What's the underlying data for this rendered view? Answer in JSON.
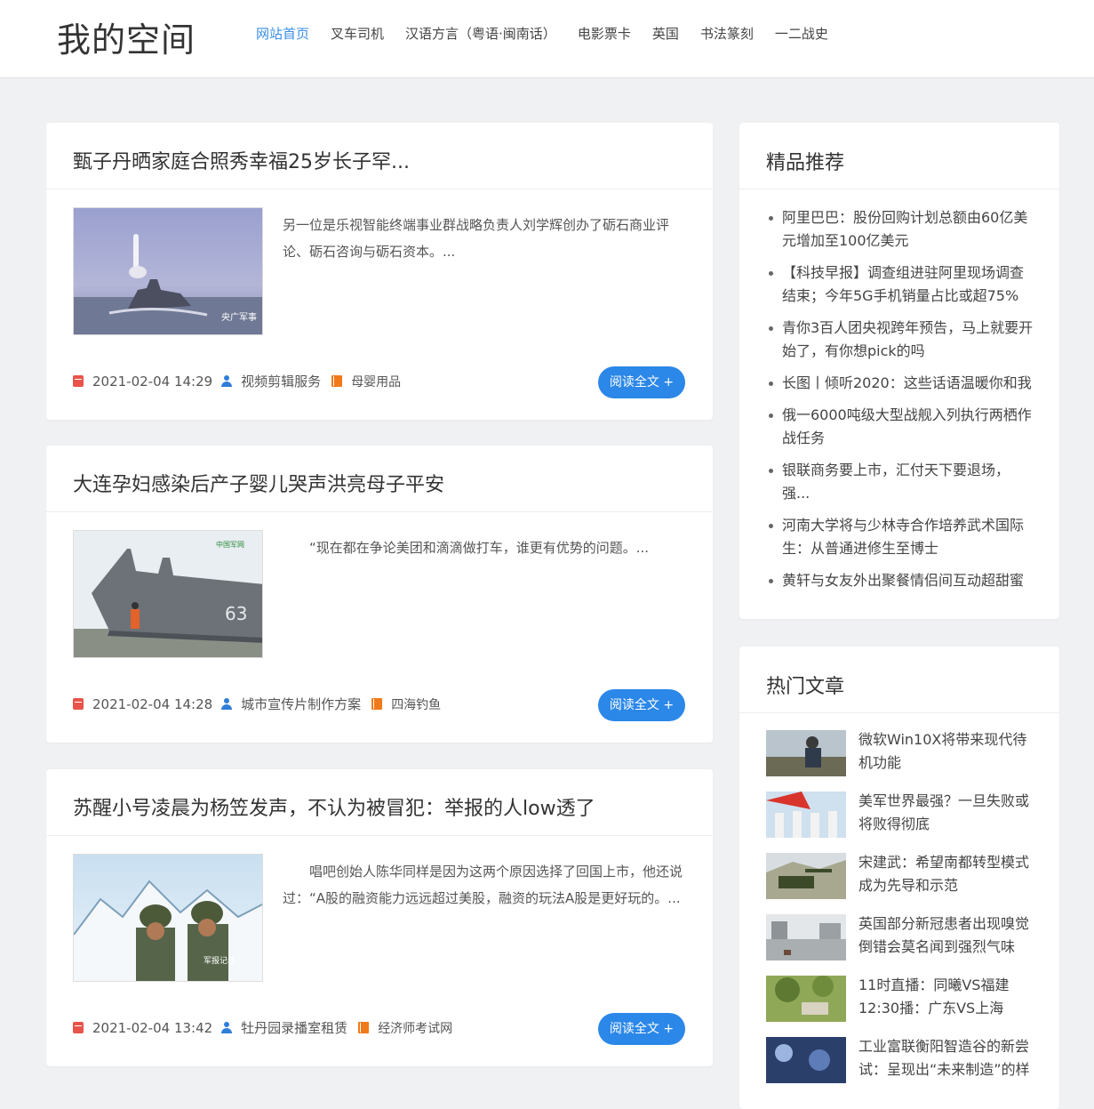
{
  "site": {
    "logo": "我的空间"
  },
  "nav": {
    "items": [
      {
        "label": "网站首页",
        "active": true
      },
      {
        "label": "叉车司机"
      },
      {
        "label": "汉语方言（粤语·闽南话）"
      },
      {
        "label": "电影票卡"
      },
      {
        "label": "英国"
      },
      {
        "label": "书法篆刻"
      },
      {
        "label": "一二战史"
      }
    ]
  },
  "articles": [
    {
      "title": "甄子丹晒家庭合照秀幸福25岁长子罕...",
      "excerpt": "另一位是乐视智能终端事业群战略负责人刘学辉创办了砺石商业评论、砺石咨询与砺石资本。...",
      "date": "2021-02-04 14:29",
      "author": "视频剪辑服务",
      "category": "母婴用品",
      "read_more": "阅读全文 +",
      "thumb_caption": "央广军事"
    },
    {
      "title": "大连孕妇感染后产子婴儿哭声洪亮母子平安",
      "excerpt": "　　“现在都在争论美团和滴滴做打车，谁更有优势的问题。...",
      "date": "2021-02-04 14:28",
      "author": "城市宣传片制作方案",
      "category": "四海钓鱼",
      "read_more": "阅读全文 +",
      "thumb_caption": "中国军网"
    },
    {
      "title": "苏醒小号凌晨为杨笠发声，不认为被冒犯：举报的人low透了",
      "excerpt": "　　唱吧创始人陈华同样是因为这两个原因选择了回国上市，他还说过：“A股的融资能力远远超过美股，融资的玩法A股是更好玩的。...",
      "date": "2021-02-04 13:42",
      "author": "牡丹园录播室租赁",
      "category": "经济师考试网",
      "read_more": "阅读全文 +",
      "thumb_caption": "军报记者"
    }
  ],
  "recommend": {
    "title": "精品推荐",
    "items": [
      "阿里巴巴：股份回购计划总额由60亿美元增加至100亿美元",
      "【科技早报】调查组进驻阿里现场调查结束；今年5G手机销量占比或超75%",
      "青你3百人团央视跨年预告，马上就要开始了，有你想pick的吗",
      "长图丨倾听2020：这些话语温暖你和我",
      "俄一6000吨级大型战舰入列执行两栖作战任务",
      "银联商务要上市，汇付天下要退场，强...",
      "河南大学将与少林寺合作培养武术国际生：从普通进修生至博士",
      "黄轩与女友外出聚餐情侣间互动超甜蜜"
    ]
  },
  "hot": {
    "title": "热门文章",
    "items": [
      "微软Win10X将带来现代待机功能",
      "美军世界最强？一旦失败或将败得彻底",
      "宋建武：希望南都转型模式成为先导和示范",
      "英国部分新冠患者出现嗅觉倒错会莫名闻到强烈气味",
      "11时直播：同曦VS福建 12:30播：广东VS上海",
      "工业富联衡阳智造谷的新尝试：呈现出“未来制造”的样"
    ]
  },
  "colors": {
    "accent": "#2b87e8",
    "nav_active": "#3a8ee6",
    "calendar_icon": "#e8534a",
    "user_icon": "#2f7ed8",
    "category_icon": "#f07a1a"
  }
}
